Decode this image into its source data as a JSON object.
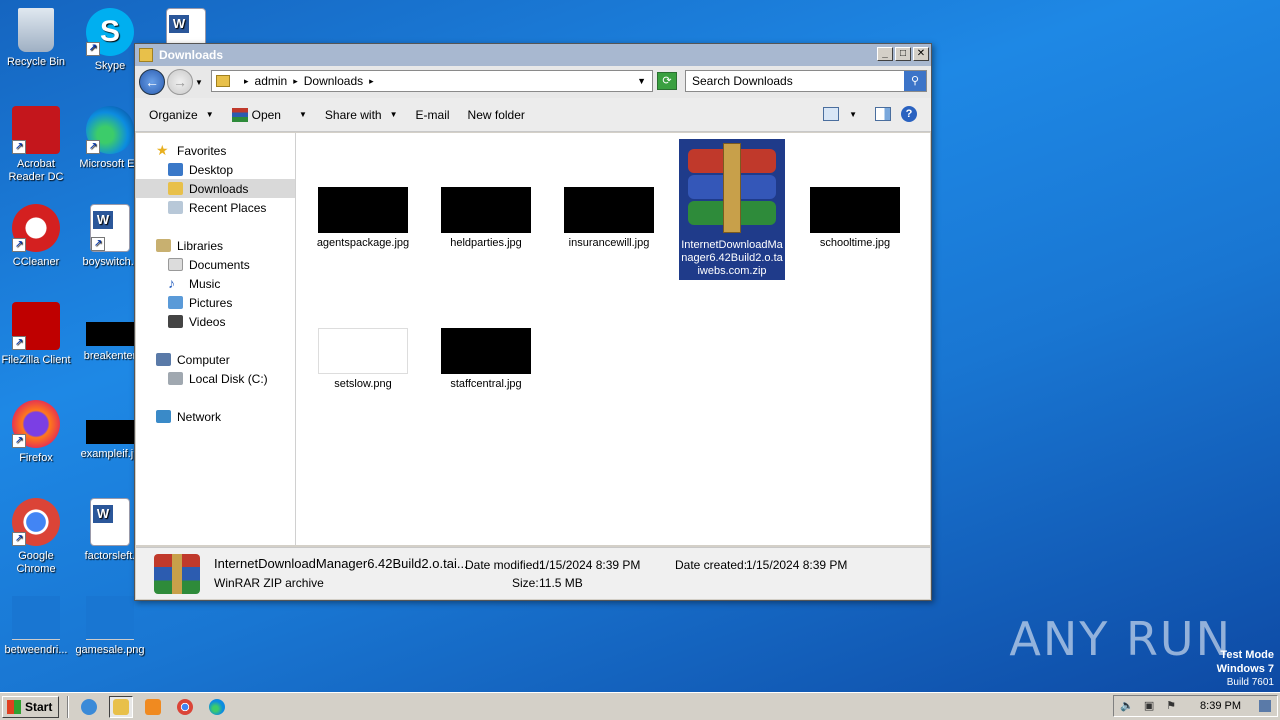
{
  "window": {
    "title": "Downloads",
    "address": {
      "parts": [
        "admin",
        "Downloads"
      ]
    },
    "search_placeholder": "Search Downloads"
  },
  "toolbar": {
    "organize": "Organize",
    "open": "Open",
    "share_with": "Share with",
    "email": "E-mail",
    "new_folder": "New folder"
  },
  "navpane": {
    "favorites": "Favorites",
    "desktop": "Desktop",
    "downloads": "Downloads",
    "recent_places": "Recent Places",
    "libraries": "Libraries",
    "documents": "Documents",
    "music": "Music",
    "pictures": "Pictures",
    "videos": "Videos",
    "computer": "Computer",
    "local_disk": "Local Disk (C:)",
    "network": "Network"
  },
  "files": [
    {
      "name": "agentspackage.jpg"
    },
    {
      "name": "heldparties.jpg"
    },
    {
      "name": "insurancewill.jpg"
    },
    {
      "name": "InternetDownloadManager6.42Build2.o.taiwebs.com.zip"
    },
    {
      "name": "schooltime.jpg"
    },
    {
      "name": "setslow.png"
    },
    {
      "name": "staffcentral.jpg"
    }
  ],
  "details": {
    "name": "InternetDownloadManager6.42Build2.o.tai...",
    "type": "WinRAR ZIP archive",
    "date_modified_label": "Date modified:",
    "date_modified": "1/15/2024 8:39 PM",
    "size_label": "Size:",
    "size": "11.5 MB",
    "date_created_label": "Date created:",
    "date_created": "1/15/2024 8:39 PM"
  },
  "desktop_icons": [
    {
      "label": "Recycle Bin",
      "icon": "recycle-bin-icon"
    },
    {
      "label": "Skype",
      "icon": "skype-icon"
    },
    {
      "label": "Acrobat Reader DC",
      "icon": "acrobat-icon"
    },
    {
      "label": "Microsoft Ed",
      "icon": "edge-icon"
    },
    {
      "label": "CCleaner",
      "icon": "ccleaner-icon"
    },
    {
      "label": "boyswitch.r",
      "icon": "word-doc-icon"
    },
    {
      "label": "FileZilla Client",
      "icon": "filezilla-icon"
    },
    {
      "label": "breakenter",
      "icon": "image-file-icon"
    },
    {
      "label": "Firefox",
      "icon": "firefox-icon"
    },
    {
      "label": "exampleif.jp",
      "icon": "image-file-icon"
    },
    {
      "label": "Google Chrome",
      "icon": "chrome-icon"
    },
    {
      "label": "factorsleft.",
      "icon": "word-doc-icon"
    },
    {
      "label": "betweendri...",
      "icon": "image-file-icon"
    },
    {
      "label": "gamesale.png",
      "icon": "image-file-icon"
    }
  ],
  "watermark": "ANY RUN",
  "test_mode": {
    "line1": "Test Mode",
    "line2": "Windows 7",
    "line3": "Build 7601"
  },
  "taskbar": {
    "start": "Start",
    "clock": "8:39 PM"
  }
}
